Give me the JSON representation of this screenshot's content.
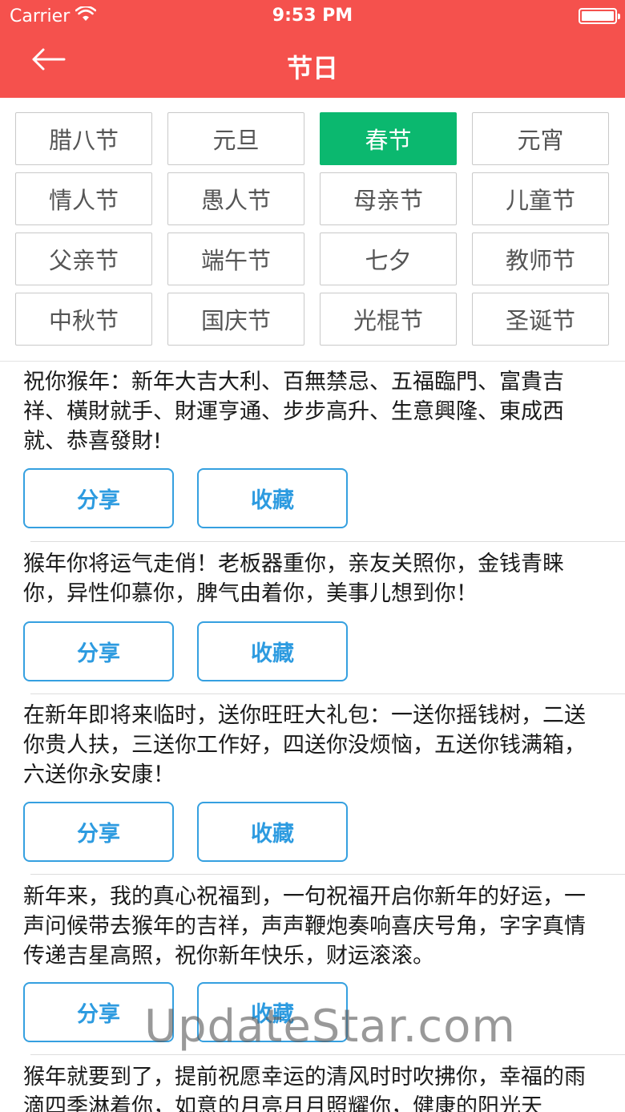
{
  "status_bar": {
    "carrier": "Carrier",
    "time": "9:53 PM",
    "wifi_icon": "wifi-icon",
    "battery_icon": "battery-icon"
  },
  "nav": {
    "title": "节日",
    "back_icon": "arrow-left-icon",
    "background_color": "#f5514d"
  },
  "holidays": {
    "selected_color": "#0bb86f",
    "items": [
      {
        "label": "腊八节",
        "selected": false
      },
      {
        "label": "元旦",
        "selected": false
      },
      {
        "label": "春节",
        "selected": true
      },
      {
        "label": "元宵",
        "selected": false
      },
      {
        "label": "情人节",
        "selected": false
      },
      {
        "label": "愚人节",
        "selected": false
      },
      {
        "label": "母亲节",
        "selected": false
      },
      {
        "label": "儿童节",
        "selected": false
      },
      {
        "label": "父亲节",
        "selected": false
      },
      {
        "label": "端午节",
        "selected": false
      },
      {
        "label": "七夕",
        "selected": false
      },
      {
        "label": "教师节",
        "selected": false
      },
      {
        "label": "中秋节",
        "selected": false
      },
      {
        "label": "国庆节",
        "selected": false
      },
      {
        "label": "光棍节",
        "selected": false
      },
      {
        "label": "圣诞节",
        "selected": false
      }
    ]
  },
  "messages": [
    {
      "text": "祝你猴年：新年大吉大利、百無禁忌、五福臨門、富貴吉祥、橫財就手、財運亨通、步步高升、生意興隆、東成西就、恭喜發財!",
      "share_label": "分享",
      "favorite_label": "收藏"
    },
    {
      "text": "猴年你将运气走俏！老板器重你，亲友关照你，金钱青睐你，异性仰慕你，脾气由着你，美事儿想到你！",
      "share_label": "分享",
      "favorite_label": "收藏"
    },
    {
      "text": "在新年即将来临时，送你旺旺大礼包：一送你摇钱树，二送你贵人扶，三送你工作好，四送你没烦恼，五送你钱满箱，六送你永安康！",
      "share_label": "分享",
      "favorite_label": "收藏"
    },
    {
      "text": "新年来，我的真心祝福到，一句祝福开启你新年的好运，一声问候带去猴年的吉祥，声声鞭炮奏响喜庆号角，字字真情传递吉星高照，祝你新年快乐，财运滚滚。",
      "share_label": "分享",
      "favorite_label": "收藏"
    },
    {
      "text": "猴年就要到了，提前祝愿幸运的清风时时吹拂你，幸福的雨滴四季淋着你，如意的月亮月月照耀你，健康的阳光天",
      "share_label": "",
      "favorite_label": ""
    }
  ],
  "watermark": "UpdateStar.com"
}
